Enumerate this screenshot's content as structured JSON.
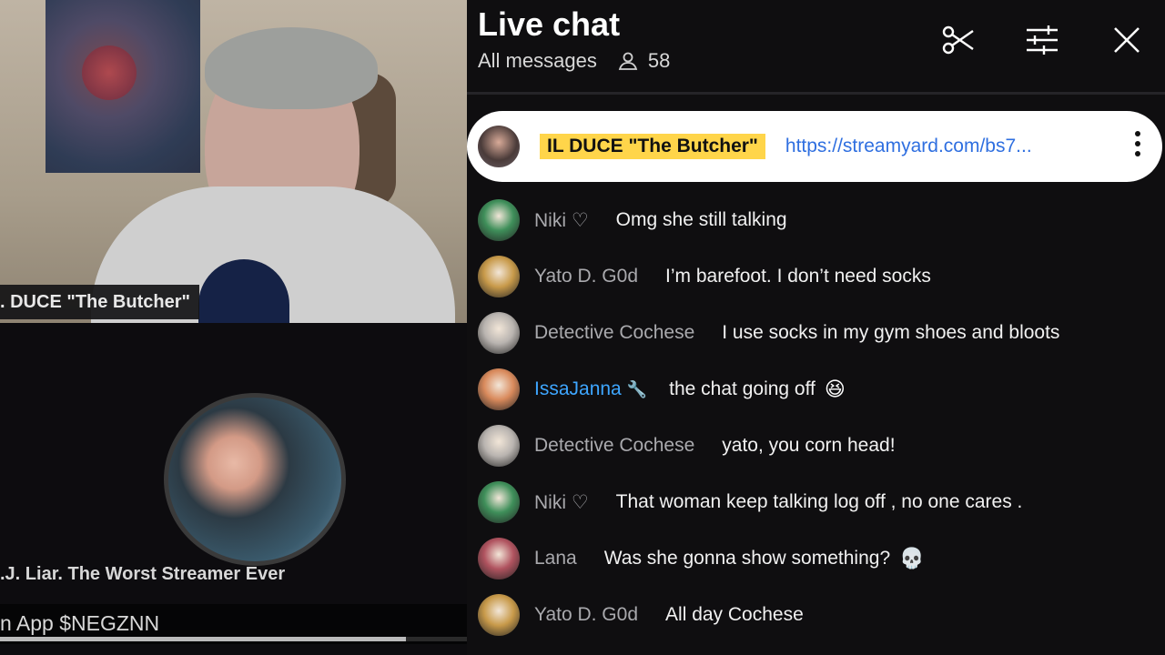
{
  "video": {
    "host_nameplate": ". DUCE \"The Butcher\"",
    "guest_nameplate": ".J. Liar. The Worst Streamer Ever",
    "ticker_text": "n App $NEGZNN",
    "progress": 0.87
  },
  "chat": {
    "title": "Live chat",
    "filter_label": "All messages",
    "viewer_count": "58",
    "pinned": {
      "author": "IL DUCE \"The Butcher\"",
      "link": "https://streamyard.com/bs7..."
    },
    "messages": [
      {
        "author": "Niki ♡",
        "text": "Omg she still talking",
        "avatar_color": "#3f8f5a",
        "mod": false,
        "badge": "",
        "emoji": ""
      },
      {
        "author": "Yato D. G0d",
        "text": "I’m barefoot. I don’t need socks",
        "avatar_color": "#c89a4a",
        "mod": false,
        "badge": "",
        "emoji": ""
      },
      {
        "author": "Detective Cochese",
        "text": "I use socks in my gym shoes and bloots",
        "avatar_color": "#b9b4b0",
        "mod": false,
        "badge": "",
        "emoji": ""
      },
      {
        "author": "IssaJanna",
        "text": "the chat going off",
        "avatar_color": "#d98a5c",
        "mod": true,
        "badge": "🔧",
        "emoji": "😆"
      },
      {
        "author": "Detective Cochese",
        "text": "yato, you corn head!",
        "avatar_color": "#b9b4b0",
        "mod": false,
        "badge": "",
        "emoji": ""
      },
      {
        "author": "Niki ♡",
        "text": "That woman keep talking log off , no one cares .",
        "avatar_color": "#3f8f5a",
        "mod": false,
        "badge": "",
        "emoji": ""
      },
      {
        "author": "Lana",
        "text": "Was she gonna show something?",
        "avatar_color": "#b0535f",
        "mod": false,
        "badge": "",
        "emoji": "💀"
      },
      {
        "author": "Yato D. G0d",
        "text": "All day Cochese",
        "avatar_color": "#c89a4a",
        "mod": false,
        "badge": "",
        "emoji": ""
      }
    ]
  }
}
